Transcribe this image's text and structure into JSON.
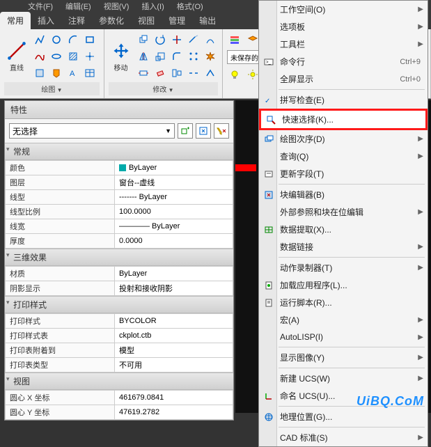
{
  "menubar": [
    "文件(F)",
    "编辑(E)",
    "视图(V)",
    "插入(I)",
    "格式(O)"
  ],
  "tabs": [
    "常用",
    "插入",
    "注释",
    "参数化",
    "视图",
    "管理",
    "输出"
  ],
  "ribbon": {
    "draw_label": "绘图",
    "line_label": "直线",
    "modify_label": "修改",
    "move_label": "移动",
    "layer_dd": "未保存的图层状"
  },
  "props": {
    "title": "特性",
    "selection": "无选择",
    "groups": [
      {
        "title": "常规",
        "rows": [
          {
            "k": "颜色",
            "v": "ByLayer",
            "color": true
          },
          {
            "k": "图层",
            "v": "窗台--虚线"
          },
          {
            "k": "线型",
            "v": "------- ByLayer"
          },
          {
            "k": "线型比例",
            "v": "100.0000"
          },
          {
            "k": "线宽",
            "v": "———— ByLayer"
          },
          {
            "k": "厚度",
            "v": "0.0000"
          }
        ]
      },
      {
        "title": "三维效果",
        "rows": [
          {
            "k": "材质",
            "v": "ByLayer"
          },
          {
            "k": "阴影显示",
            "v": "投射和接收阴影"
          }
        ]
      },
      {
        "title": "打印样式",
        "rows": [
          {
            "k": "打印样式",
            "v": "BYCOLOR"
          },
          {
            "k": "打印样式表",
            "v": "ckplot.ctb"
          },
          {
            "k": "打印表附着到",
            "v": "模型"
          },
          {
            "k": "打印表类型",
            "v": "不可用"
          }
        ]
      },
      {
        "title": "视图",
        "rows": [
          {
            "k": "圆心 X 坐标",
            "v": "461679.0841"
          },
          {
            "k": "圆心 Y 坐标",
            "v": "47619.2782"
          }
        ]
      }
    ]
  },
  "menu": [
    {
      "t": "item",
      "label": "工作空间(O)",
      "sub": true
    },
    {
      "t": "item",
      "label": "选项板",
      "sub": true
    },
    {
      "t": "item",
      "label": "工具栏",
      "sub": true
    },
    {
      "t": "item",
      "label": "命令行",
      "shortcut": "Ctrl+9",
      "icon": "cli"
    },
    {
      "t": "item",
      "label": "全屏显示",
      "shortcut": "Ctrl+0"
    },
    {
      "t": "sep"
    },
    {
      "t": "item",
      "label": "拼写检查(E)",
      "icon": "spell"
    },
    {
      "t": "item",
      "label": "快速选择(K)...",
      "icon": "qselect",
      "highlight": true
    },
    {
      "t": "item",
      "label": "绘图次序(D)",
      "sub": true,
      "icon": "order"
    },
    {
      "t": "item",
      "label": "查询(Q)",
      "sub": true
    },
    {
      "t": "item",
      "label": "更新字段(T)",
      "icon": "field"
    },
    {
      "t": "sep"
    },
    {
      "t": "item",
      "label": "块编辑器(B)",
      "icon": "block"
    },
    {
      "t": "item",
      "label": "外部参照和块在位编辑",
      "sub": true
    },
    {
      "t": "item",
      "label": "数据提取(X)...",
      "icon": "extract"
    },
    {
      "t": "item",
      "label": "数据链接",
      "sub": true
    },
    {
      "t": "sep"
    },
    {
      "t": "item",
      "label": "动作录制器(T)",
      "sub": true
    },
    {
      "t": "item",
      "label": "加载应用程序(L)...",
      "icon": "load"
    },
    {
      "t": "item",
      "label": "运行脚本(R)...",
      "icon": "script"
    },
    {
      "t": "item",
      "label": "宏(A)",
      "sub": true
    },
    {
      "t": "item",
      "label": "AutoLISP(I)",
      "sub": true
    },
    {
      "t": "sep"
    },
    {
      "t": "item",
      "label": "显示图像(Y)",
      "sub": true
    },
    {
      "t": "sep"
    },
    {
      "t": "item",
      "label": "新建 UCS(W)",
      "sub": true
    },
    {
      "t": "item",
      "label": "命名 UCS(U)...",
      "icon": "ucs"
    },
    {
      "t": "sep"
    },
    {
      "t": "item",
      "label": "地理位置(G)...",
      "icon": "geo"
    },
    {
      "t": "sep"
    },
    {
      "t": "item",
      "label": "CAD 标准(S)",
      "sub": true
    }
  ],
  "watermark": "UiBQ.CoM"
}
